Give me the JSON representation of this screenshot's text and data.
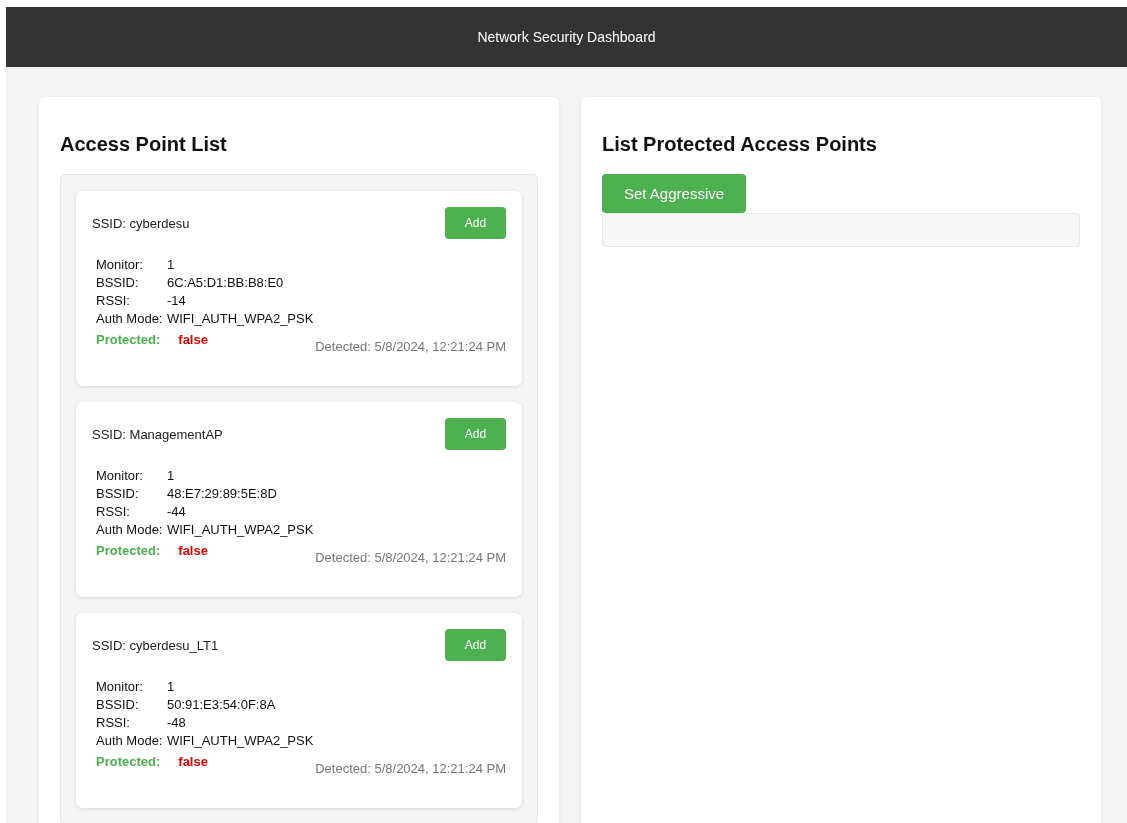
{
  "header": {
    "title": "Network Security Dashboard"
  },
  "access_points": {
    "title": "Access Point List",
    "items": [
      {
        "ssid": "SSID: cyberdesu",
        "add_button": "Add",
        "fields": [
          {
            "label": "Monitor:",
            "value": "1"
          },
          {
            "label": "BSSID:",
            "value": "6C:A5:D1:BB:B8:E0"
          },
          {
            "label": "RSSI:",
            "value": "-14"
          },
          {
            "label": "Auth Mode:",
            "value": "WIFI_AUTH_WPA2_PSK"
          }
        ],
        "protected_label": "Protected:",
        "protected_text": "false",
        "protected": false,
        "detected": "Detected: 5/8/2024, 12:21:24 PM"
      },
      {
        "ssid": "SSID: ManagementAP",
        "add_button": "Add",
        "fields": [
          {
            "label": "Monitor:",
            "value": "1"
          },
          {
            "label": "BSSID:",
            "value": "48:E7:29:89:5E:8D"
          },
          {
            "label": "RSSI:",
            "value": "-44"
          },
          {
            "label": "Auth Mode:",
            "value": "WIFI_AUTH_WPA2_PSK"
          }
        ],
        "protected_label": "Protected:",
        "protected_text": "false",
        "protected": false,
        "detected": "Detected: 5/8/2024, 12:21:24 PM"
      },
      {
        "ssid": "SSID: cyberdesu_LT1",
        "add_button": "Add",
        "fields": [
          {
            "label": "Monitor:",
            "value": "1"
          },
          {
            "label": "BSSID:",
            "value": "50:91:E3:54:0F:8A"
          },
          {
            "label": "RSSI:",
            "value": "-48"
          },
          {
            "label": "Auth Mode:",
            "value": "WIFI_AUTH_WPA2_PSK"
          }
        ],
        "protected_label": "Protected:",
        "protected_text": "false",
        "protected": false,
        "detected": "Detected: 5/8/2024, 12:21:24 PM"
      }
    ]
  },
  "protected_list": {
    "title": "List Protected Access Points",
    "button": "Set Aggressive"
  }
}
